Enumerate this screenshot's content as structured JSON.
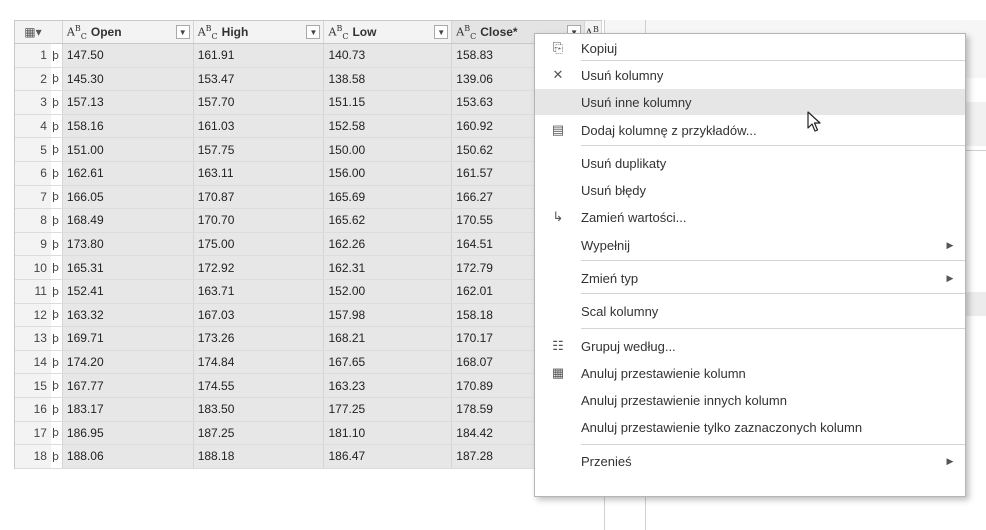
{
  "grid": {
    "columns": [
      {
        "key": "open",
        "label": "Open",
        "type_icon": "text-type-icon"
      },
      {
        "key": "high",
        "label": "High",
        "type_icon": "text-type-icon"
      },
      {
        "key": "low",
        "label": "Low",
        "type_icon": "text-type-icon"
      },
      {
        "key": "close",
        "label": "Close*",
        "type_icon": "text-type-icon"
      }
    ],
    "rows": [
      {
        "n": "1",
        "open": "147.50",
        "high": "161.91",
        "low": "140.73",
        "close": "158.83"
      },
      {
        "n": "2",
        "open": "145.30",
        "high": "153.47",
        "low": "138.58",
        "close": "139.06"
      },
      {
        "n": "3",
        "open": "157.13",
        "high": "157.70",
        "low": "151.15",
        "close": "153.63"
      },
      {
        "n": "4",
        "open": "158.16",
        "high": "161.03",
        "low": "152.58",
        "close": "160.92"
      },
      {
        "n": "5",
        "open": "151.00",
        "high": "157.75",
        "low": "150.00",
        "close": "150.62"
      },
      {
        "n": "6",
        "open": "162.61",
        "high": "163.11",
        "low": "156.00",
        "close": "161.57"
      },
      {
        "n": "7",
        "open": "166.05",
        "high": "170.87",
        "low": "165.69",
        "close": "166.27"
      },
      {
        "n": "8",
        "open": "168.49",
        "high": "170.70",
        "low": "165.62",
        "close": "170.55"
      },
      {
        "n": "9",
        "open": "173.80",
        "high": "175.00",
        "low": "162.26",
        "close": "164.51"
      },
      {
        "n": "10",
        "open": "165.31",
        "high": "172.92",
        "low": "162.31",
        "close": "172.79"
      },
      {
        "n": "11",
        "open": "152.41",
        "high": "163.71",
        "low": "152.00",
        "close": "162.01"
      },
      {
        "n": "12",
        "open": "163.32",
        "high": "167.03",
        "low": "157.98",
        "close": "158.18"
      },
      {
        "n": "13",
        "open": "169.71",
        "high": "173.26",
        "low": "168.21",
        "close": "170.17"
      },
      {
        "n": "14",
        "open": "174.20",
        "high": "174.84",
        "low": "167.65",
        "close": "168.07"
      },
      {
        "n": "15",
        "open": "167.77",
        "high": "174.55",
        "low": "163.23",
        "close": "170.89"
      },
      {
        "n": "16",
        "open": "183.17",
        "high": "183.50",
        "low": "177.25",
        "close": "178.59"
      },
      {
        "n": "17",
        "open": "186.95",
        "high": "187.25",
        "low": "181.10",
        "close": "184.42"
      },
      {
        "n": "18",
        "open": "188.06",
        "high": "188.18",
        "low": "186.47",
        "close": "187.28"
      }
    ]
  },
  "context_menu": {
    "items": [
      {
        "label": "Kopiuj",
        "icon": "copy-icon"
      },
      {
        "label": "Usuń kolumny",
        "icon": "remove-columns-icon"
      },
      {
        "label": "Usuń inne kolumny",
        "icon": "",
        "hover": true
      },
      {
        "label": "Dodaj kolumnę z przykładów...",
        "icon": "column-from-examples-icon"
      },
      {
        "label": "Usuń duplikaty",
        "icon": ""
      },
      {
        "label": "Usuń błędy",
        "icon": ""
      },
      {
        "label": "Zamień wartości...",
        "icon": "replace-values-icon"
      },
      {
        "label": "Wypełnij",
        "icon": "",
        "submenu": true
      },
      {
        "label": "Zmień typ",
        "icon": "",
        "submenu": true
      },
      {
        "label": "Scal kolumny",
        "icon": ""
      },
      {
        "label": "Grupuj według...",
        "icon": "group-by-icon"
      },
      {
        "label": "Anuluj przestawienie kolumn",
        "icon": "unpivot-icon"
      },
      {
        "label": "Anuluj przestawienie innych kolumn",
        "icon": ""
      },
      {
        "label": "Anuluj przestawienie tylko zaznaczonych kolumn",
        "icon": ""
      },
      {
        "label": "Przenieś",
        "icon": "",
        "submenu": true
      }
    ]
  },
  "colors": {
    "selected_column_bg": "#e7e7e7",
    "menu_hover_bg": "#e6e6e6",
    "header_bg": "#f3f3f3"
  }
}
